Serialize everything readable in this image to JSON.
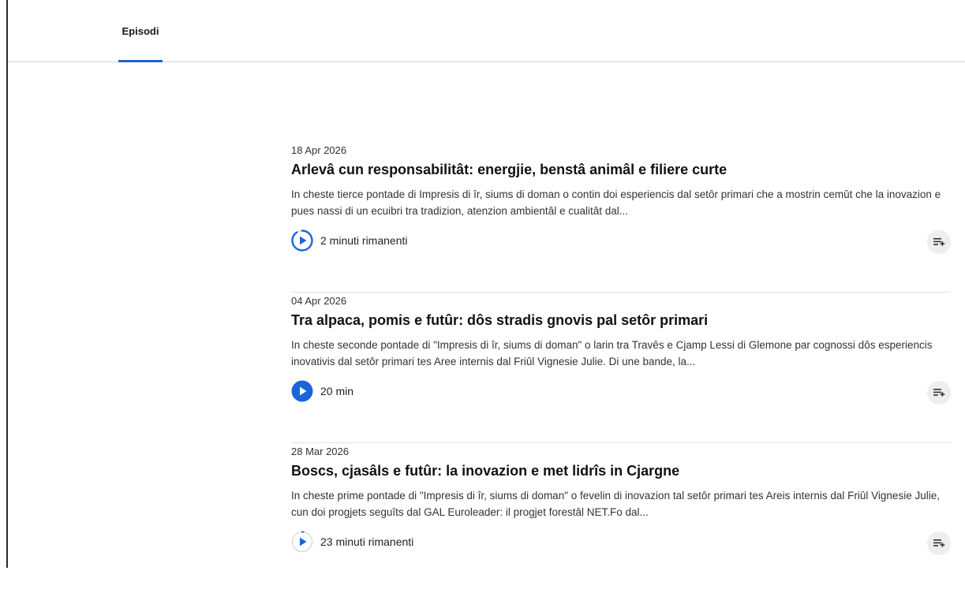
{
  "tabs": [
    {
      "label": "Episodi",
      "active": true
    }
  ],
  "accent_color": "#1a66d9",
  "episodes": [
    {
      "date": "18 Apr 2026",
      "title": "Arlevâ cun responsabilitât: energjie, benstâ animâl e filiere curte",
      "description": "In cheste tierce pontade di Impresis di îr, siums di doman o contin doi esperiencis dal setôr primari che a mostrin cemût che la inovazion e pues nassi di un ecuibri tra tradizion, atenzion ambientâl e cualitât dal...",
      "duration": "2 minuti rimanenti",
      "play_state": "in-progress",
      "progress": 0.9,
      "play_icon": "play-progress-icon",
      "queue_icon": "add-to-queue-icon"
    },
    {
      "date": "04 Apr 2026",
      "title": "Tra alpaca, pomis e futûr: dôs stradis gnovis pal setôr primari",
      "description": "In cheste seconde pontade di \"Impresis di îr, siums di doman\" o larin tra Travês e Cjamp Lessi di Glemone par cognossi dôs esperiencis inovativis dal setôr primari tes Aree internis dal Friûl Vignesie Julie. Di une bande, la...",
      "duration": "20 min",
      "play_state": "unplayed",
      "progress": 0,
      "play_icon": "play-icon",
      "queue_icon": "add-to-queue-icon"
    },
    {
      "date": "28 Mar 2026",
      "title": "Boscs, cjasâls e futûr: la inovazion e met lidrîs in Cjargne",
      "description": "In cheste prime pontade di \"Impresis di îr, siums di doman\" o fevelin di inovazion tal setôr primari tes Areis internis dal Friûl Vignesie Julie, cun doi progjets seguîts dal GAL Euroleader: il progjet forestâl NET.Fo dal...",
      "duration": "23 minuti rimanenti",
      "play_state": "in-progress",
      "progress": 0.02,
      "play_icon": "play-progress-icon",
      "queue_icon": "add-to-queue-icon"
    }
  ]
}
